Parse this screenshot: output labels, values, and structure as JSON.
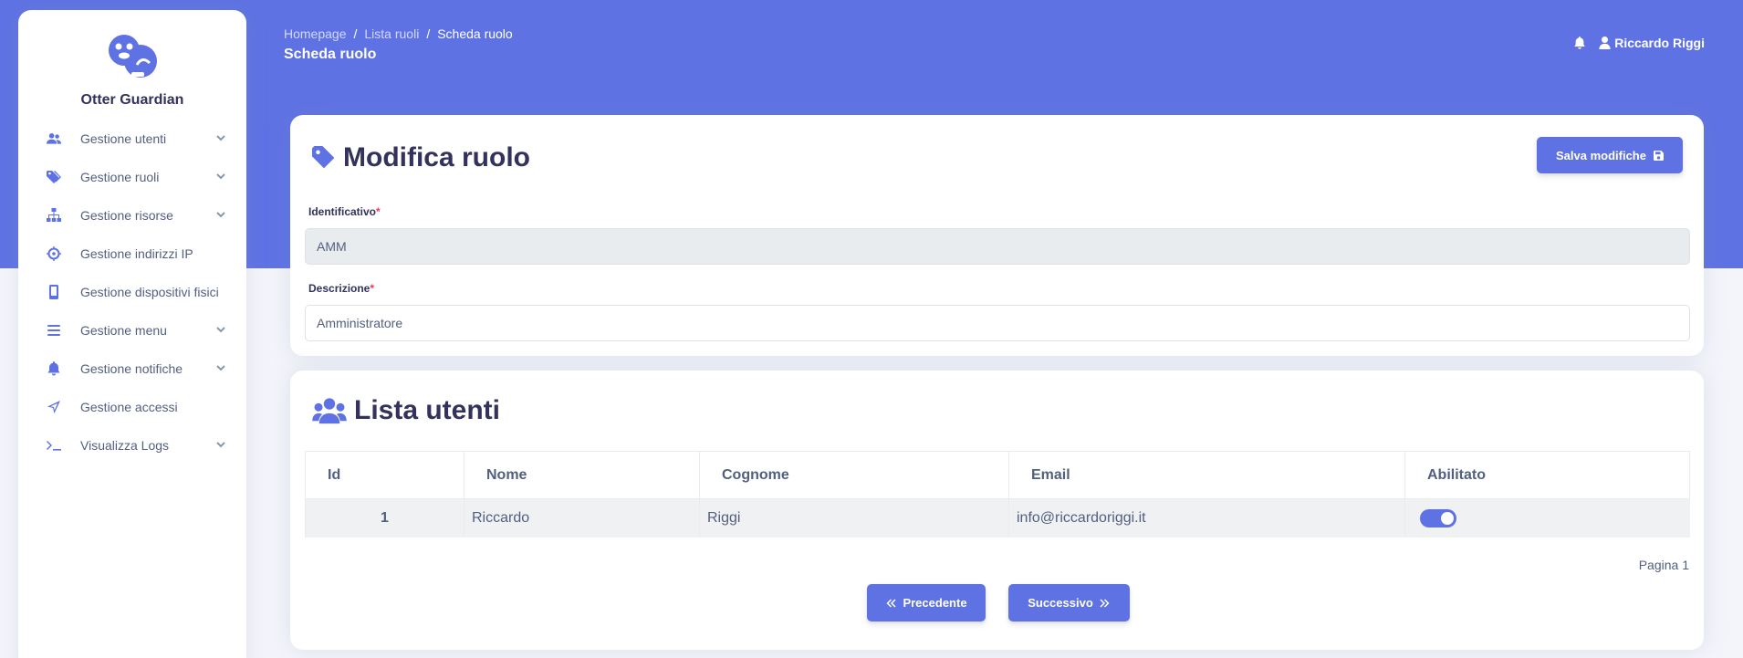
{
  "app": {
    "name": "Otter Guardian"
  },
  "sidebar": {
    "items": [
      {
        "label": "Gestione utenti",
        "icon": "users-icon",
        "expandable": true
      },
      {
        "label": "Gestione ruoli",
        "icon": "tags-icon",
        "expandable": true
      },
      {
        "label": "Gestione risorse",
        "icon": "sitemap-icon",
        "expandable": true
      },
      {
        "label": "Gestione indirizzi IP",
        "icon": "crosshairs-icon",
        "expandable": false
      },
      {
        "label": "Gestione dispositivi fisici",
        "icon": "mobile-icon",
        "expandable": false
      },
      {
        "label": "Gestione menu",
        "icon": "bars-icon",
        "expandable": true
      },
      {
        "label": "Gestione notifiche",
        "icon": "bell-icon",
        "expandable": true
      },
      {
        "label": "Gestione accessi",
        "icon": "location-arrow-icon",
        "expandable": false
      },
      {
        "label": "Visualizza Logs",
        "icon": "terminal-icon",
        "expandable": true
      }
    ]
  },
  "header": {
    "breadcrumb": [
      "Homepage",
      "Lista ruoli",
      "Scheda ruolo"
    ],
    "title": "Scheda ruolo",
    "user": "Riccardo Riggi"
  },
  "role_form": {
    "title": "Modifica ruolo",
    "save_label": "Salva modifiche",
    "id_label": "Identificativo",
    "id_value": "AMM",
    "desc_label": "Descrizione",
    "desc_value": "Amministratore",
    "required_mark": "*"
  },
  "users_list": {
    "title": "Lista utenti",
    "columns": [
      "Id",
      "Nome",
      "Cognome",
      "Email",
      "Abilitato"
    ],
    "rows": [
      {
        "id": "1",
        "nome": "Riccardo",
        "cognome": "Riggi",
        "email": "info@riccardoriggi.it",
        "abilitato": true
      }
    ],
    "page_info": "Pagina 1",
    "prev_label": "Precedente",
    "next_label": "Successivo"
  },
  "colors": {
    "primary": "#5e72e4",
    "text": "#32325d",
    "muted": "#525f7f"
  }
}
